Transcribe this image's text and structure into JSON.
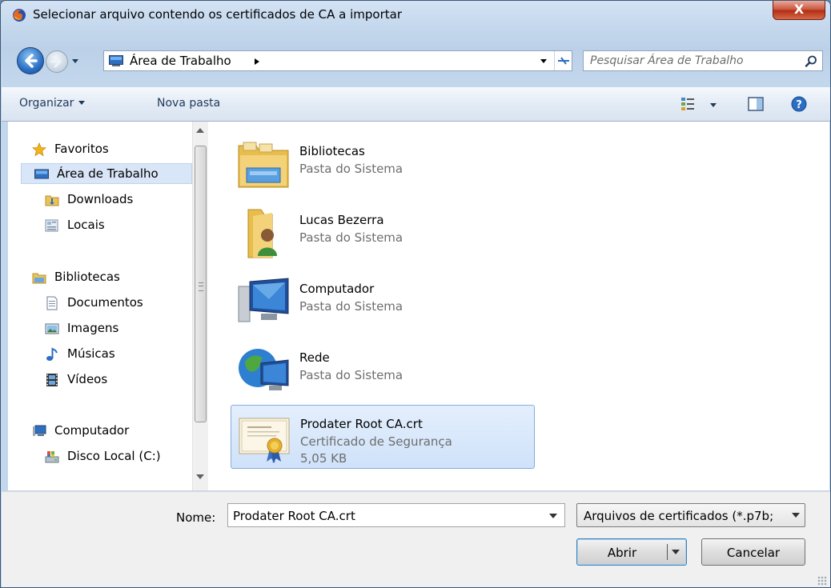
{
  "window": {
    "title": "Selecionar arquivo contendo os certificados de CA a importar",
    "close_glyph": "X"
  },
  "address": {
    "path": "Área de Trabalho",
    "search_placeholder": "Pesquisar Área de Trabalho"
  },
  "toolbar": {
    "organize": "Organizar",
    "new_folder": "Nova pasta"
  },
  "sidebar": {
    "items": [
      {
        "label": "Favoritos",
        "icon": "star-icon"
      },
      {
        "label": "Área de Trabalho",
        "icon": "desktop-icon",
        "selected": true
      },
      {
        "label": "Downloads",
        "icon": "downloads-folder-icon"
      },
      {
        "label": "Locais",
        "icon": "recent-places-icon"
      },
      {
        "label": "Bibliotecas",
        "icon": "libraries-icon"
      },
      {
        "label": "Documentos",
        "icon": "documents-icon"
      },
      {
        "label": "Imagens",
        "icon": "pictures-icon"
      },
      {
        "label": "Músicas",
        "icon": "music-icon"
      },
      {
        "label": "Vídeos",
        "icon": "videos-icon"
      },
      {
        "label": "Computador",
        "icon": "computer-icon"
      },
      {
        "label": "Disco Local (C:)",
        "icon": "local-disk-icon"
      }
    ]
  },
  "files": [
    {
      "name": "Bibliotecas",
      "type": "Pasta do Sistema",
      "icon": "libraries-folder-icon"
    },
    {
      "name": "Lucas Bezerra",
      "type": "Pasta do Sistema",
      "icon": "user-folder-icon"
    },
    {
      "name": "Computador",
      "type": "Pasta do Sistema",
      "icon": "computer-icon"
    },
    {
      "name": "Rede",
      "type": "Pasta do Sistema",
      "icon": "network-icon"
    },
    {
      "name": "Prodater Root CA.crt",
      "type": "Certificado de Segurança",
      "size": "5,05 KB",
      "icon": "certificate-icon",
      "selected": true
    }
  ],
  "footer": {
    "name_label": "Nome:",
    "name_value": "Prodater Root CA.crt",
    "file_type": "Arquivos de certificados (*.p7b;",
    "open_label": "Abrir",
    "cancel_label": "Cancelar"
  }
}
